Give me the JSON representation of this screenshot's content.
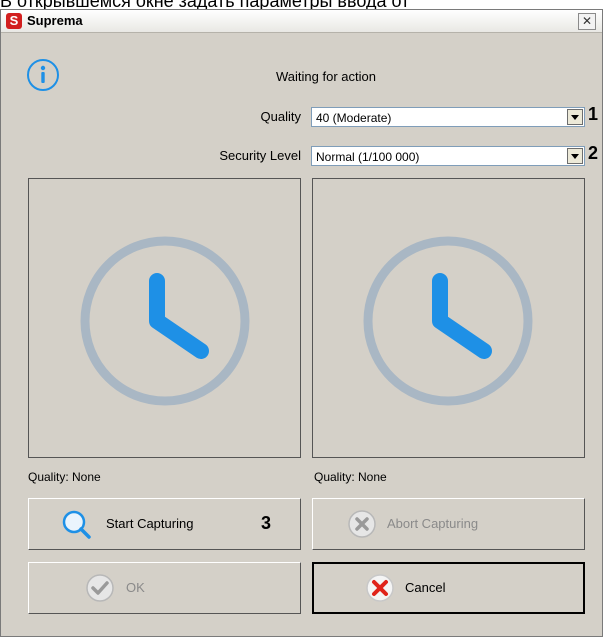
{
  "page_caption": "В открывшемся окне задать параметры ввода от",
  "window": {
    "title": "Suprema",
    "close_glyph": "✕",
    "logo_letter": "S"
  },
  "status_text": "Waiting for action",
  "quality": {
    "label": "Quality",
    "value": "40 (Moderate)",
    "marker": "1"
  },
  "security": {
    "label": "Security Level",
    "value": "Normal (1/100 000)",
    "marker": "2"
  },
  "left_panel": {
    "quality_label": "Quality: None"
  },
  "right_panel": {
    "quality_label": "Quality: None"
  },
  "buttons": {
    "start": "Start Capturing",
    "start_marker": "3",
    "abort": "Abort Capturing",
    "ok": "OK",
    "cancel": "Cancel"
  },
  "colors": {
    "accent": "#1e90e6",
    "clock_ring": "#a9b7c4",
    "cancel_x": "#e0231a"
  },
  "icons": [
    "info-icon",
    "clock-icon",
    "search-icon",
    "x-circle-icon",
    "check-circle-icon",
    "cancel-x-icon"
  ]
}
